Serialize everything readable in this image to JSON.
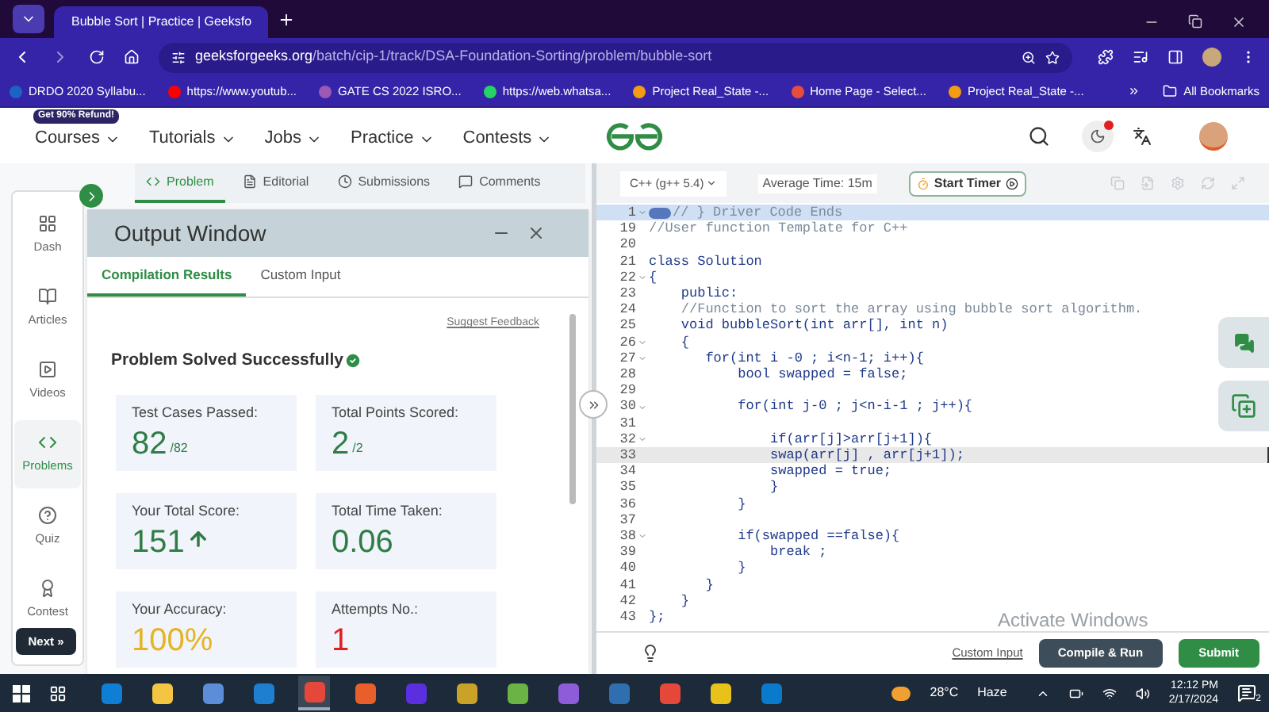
{
  "browser": {
    "tab_title": "Bubble Sort | Practice | Geeksfo",
    "url_host": "geeksforgeeks.org",
    "url_path": "/batch/cip-1/track/DSA-Foundation-Sorting/problem/bubble-sort",
    "bookmarks": [
      {
        "label": "DRDO 2020 Syllabu...",
        "color": "#1e63c4"
      },
      {
        "label": "https://www.youtub...",
        "color": "#ff0000"
      },
      {
        "label": "GATE CS 2022 ISRO...",
        "color": "#9b59b6"
      },
      {
        "label": "https://web.whatsa...",
        "color": "#25d366"
      },
      {
        "label": "Project Real_State -...",
        "color": "#f39c12"
      },
      {
        "label": "Home Page - Select...",
        "color": "#e74c3c"
      },
      {
        "label": "Project Real_State -...",
        "color": "#f39c12"
      }
    ],
    "all_bookmarks": "All Bookmarks"
  },
  "site_nav": {
    "badge": "Get 90% Refund!",
    "items": [
      "Courses",
      "Tutorials",
      "Jobs",
      "Practice",
      "Contests"
    ]
  },
  "problem_tabs": [
    {
      "label": "Problem",
      "selected": true
    },
    {
      "label": "Editorial",
      "selected": false
    },
    {
      "label": "Submissions",
      "selected": false
    },
    {
      "label": "Comments",
      "selected": false
    }
  ],
  "sidebar": [
    {
      "label": "Dash",
      "selected": false
    },
    {
      "label": "Articles",
      "selected": false
    },
    {
      "label": "Videos",
      "selected": false
    },
    {
      "label": "Problems",
      "selected": true
    },
    {
      "label": "Quiz",
      "selected": false
    },
    {
      "label": "Contest",
      "selected": false
    }
  ],
  "next_button": "Next »",
  "output_window": {
    "title": "Output Window",
    "tabs": [
      {
        "label": "Compilation Results",
        "selected": true
      },
      {
        "label": "Custom Input",
        "selected": false
      }
    ],
    "feedback_link": "Suggest Feedback",
    "status": "Problem Solved Successfully",
    "cards": [
      {
        "label": "Test Cases Passed:",
        "value": "82",
        "suffix": "/82",
        "color": "#2f7d46",
        "arrow": false
      },
      {
        "label": "Total Points Scored:",
        "value": "2",
        "suffix": "/2",
        "color": "#2f7d46",
        "arrow": false
      },
      {
        "label": "Your Total Score:",
        "value": "151",
        "color": "#2f7d46",
        "arrow": true
      },
      {
        "label": "Total Time Taken:",
        "value": "0.06",
        "color": "#2f7d46",
        "arrow": false
      },
      {
        "label": "Your Accuracy:",
        "value": "100%",
        "color": "#e6b325",
        "arrow": false
      },
      {
        "label": "Attempts No.:",
        "value": "1",
        "color": "#e0201f",
        "arrow": false
      }
    ]
  },
  "editor": {
    "language": "C++ (g++ 5.4)",
    "average_time": "Average Time: 15m",
    "timer_button": "Start Timer",
    "lines": [
      {
        "n": "1",
        "fold": true,
        "folded": true,
        "cursor": false,
        "kind": "comment",
        "text": "// } Driver Code Ends"
      },
      {
        "n": "19",
        "fold": false,
        "folded": false,
        "cursor": false,
        "kind": "comment",
        "text": "//User function Template for C++"
      },
      {
        "n": "20",
        "fold": false,
        "folded": false,
        "cursor": false,
        "kind": "code"
      },
      {
        "n": "21",
        "fold": false,
        "folded": false,
        "cursor": false,
        "kind": "code",
        "text": "class Solution"
      },
      {
        "n": "22",
        "fold": true,
        "folded": false,
        "cursor": false,
        "kind": "code",
        "text": "{"
      },
      {
        "n": "23",
        "fold": false,
        "folded": false,
        "cursor": false,
        "kind": "code",
        "text": "    public:"
      },
      {
        "n": "24",
        "fold": false,
        "folded": false,
        "cursor": false,
        "kind": "comment",
        "text": "    //Function to sort the array using bubble sort algorithm."
      },
      {
        "n": "25",
        "fold": false,
        "folded": false,
        "cursor": false,
        "kind": "code",
        "text": "    void bubbleSort(int arr[], int n)"
      },
      {
        "n": "26",
        "fold": true,
        "folded": false,
        "cursor": false,
        "kind": "code",
        "text": "    {"
      },
      {
        "n": "27",
        "fold": true,
        "folded": false,
        "cursor": false,
        "kind": "code",
        "text": "       for(int i -0 ; i<n-1; i++){"
      },
      {
        "n": "28",
        "fold": false,
        "folded": false,
        "cursor": false,
        "kind": "code",
        "text": "           bool swapped = false;"
      },
      {
        "n": "29",
        "fold": false,
        "folded": false,
        "cursor": false,
        "kind": "code"
      },
      {
        "n": "30",
        "fold": true,
        "folded": false,
        "cursor": false,
        "kind": "code",
        "text": "           for(int j-0 ; j<n-i-1 ; j++){"
      },
      {
        "n": "31",
        "fold": false,
        "folded": false,
        "cursor": false,
        "kind": "code"
      },
      {
        "n": "32",
        "fold": true,
        "folded": false,
        "cursor": false,
        "kind": "code",
        "text": "               if(arr[j]>arr[j+1]){"
      },
      {
        "n": "33",
        "fold": false,
        "folded": false,
        "cursor": true,
        "kind": "code",
        "text": "               swap(arr[j] , arr[j+1]);"
      },
      {
        "n": "34",
        "fold": false,
        "folded": false,
        "cursor": false,
        "kind": "code",
        "text": "               swapped = true;"
      },
      {
        "n": "35",
        "fold": false,
        "folded": false,
        "cursor": false,
        "kind": "code",
        "text": "               }"
      },
      {
        "n": "36",
        "fold": false,
        "folded": false,
        "cursor": false,
        "kind": "code",
        "text": "           }"
      },
      {
        "n": "37",
        "fold": false,
        "folded": false,
        "cursor": false,
        "kind": "code"
      },
      {
        "n": "38",
        "fold": true,
        "folded": false,
        "cursor": false,
        "kind": "code",
        "text": "           if(swapped ==false){"
      },
      {
        "n": "39",
        "fold": false,
        "folded": false,
        "cursor": false,
        "kind": "code",
        "text": "               break ;"
      },
      {
        "n": "40",
        "fold": false,
        "folded": false,
        "cursor": false,
        "kind": "code",
        "text": "           }"
      },
      {
        "n": "41",
        "fold": false,
        "folded": false,
        "cursor": false,
        "kind": "code",
        "text": "       }"
      },
      {
        "n": "42",
        "fold": false,
        "folded": false,
        "cursor": false,
        "kind": "code",
        "text": "    }"
      },
      {
        "n": "43",
        "fold": false,
        "folded": false,
        "cursor": false,
        "kind": "code",
        "text": "};"
      }
    ],
    "custom_input": "Custom Input",
    "compile_button": "Compile & Run",
    "submit_button": "Submit"
  },
  "os_notice": "Activate Windows",
  "taskbar": {
    "apps": [
      {
        "color": "#0f7fd6",
        "selected": false
      },
      {
        "color": "#f4c542",
        "selected": false
      },
      {
        "color": "#5b8dd9",
        "selected": false
      },
      {
        "color": "#1e7fd1",
        "selected": false
      },
      {
        "color": "#e5483a",
        "selected": true
      },
      {
        "color": "#e95f2b",
        "selected": false
      },
      {
        "color": "#5b2ee0",
        "selected": false
      },
      {
        "color": "#c9a227",
        "selected": false
      },
      {
        "color": "#6ab344",
        "selected": false
      },
      {
        "color": "#8e5cd9",
        "selected": false
      },
      {
        "color": "#2f6fb0",
        "selected": false
      },
      {
        "color": "#e5483a",
        "selected": false
      },
      {
        "color": "#e8c21a",
        "selected": false
      },
      {
        "color": "#0a7acc",
        "selected": false
      }
    ],
    "temperature": "28°C",
    "weather": "Haze",
    "time": "12:12 PM",
    "date": "2/17/2024",
    "notifications": "2"
  }
}
